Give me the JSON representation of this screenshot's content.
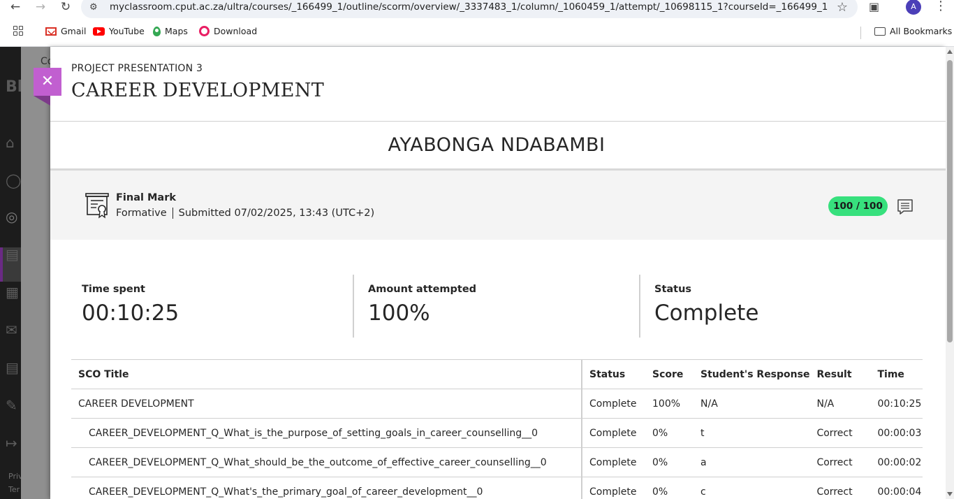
{
  "browser": {
    "url": "myclassroom.cput.ac.za/ultra/courses/_166499_1/outline/scorm/overview/_3337483_1/column/_1060459_1/attempt/_10698115_1?courseId=_166499_1",
    "profile_initial": "A",
    "bookmarks": [
      {
        "label": "Gmail",
        "icon": "gmail-icon"
      },
      {
        "label": "YouTube",
        "icon": "youtube-icon"
      },
      {
        "label": "Maps",
        "icon": "maps-icon"
      },
      {
        "label": "Download",
        "icon": "download-icon"
      }
    ],
    "all_bookmarks": "All Bookmarks"
  },
  "background": {
    "partial_text_1": "Co",
    "partial_logo": "Bl",
    "footer_1": "Priv",
    "footer_2": "Ter"
  },
  "panel": {
    "kicker": "PROJECT PRESENTATION 3",
    "title": "CAREER DEVELOPMENT",
    "student_name": "AYABONGA NDABAMBI",
    "grade": {
      "label": "Final Mark",
      "type": "Formative",
      "submitted": "Submitted 07/02/2025, 13:43 (UTC+2)",
      "score": "100 / 100",
      "score_fraction": 1.0
    },
    "stats": [
      {
        "label": "Time spent",
        "value": "00:10:25"
      },
      {
        "label": "Amount attempted",
        "value": "100%"
      },
      {
        "label": "Status",
        "value": "Complete"
      }
    ],
    "table": {
      "headers": [
        "SCO Title",
        "Status",
        "Score",
        "Student's Response",
        "Result",
        "Time"
      ],
      "rows": [
        {
          "title": "CAREER DEVELOPMENT",
          "status": "Complete",
          "score": "100%",
          "response": "N/A",
          "result": "N/A",
          "time": "00:10:25"
        },
        {
          "title": "CAREER_DEVELOPMENT_Q_What_is_the_purpose_of_setting_goals_in_career_counselling__0",
          "status": "Complete",
          "score": "0%",
          "response": "t",
          "result": "Correct",
          "time": "00:00:03"
        },
        {
          "title": "CAREER_DEVELOPMENT_Q_What_should_be_the_outcome_of_effective_career_counselling__0",
          "status": "Complete",
          "score": "0%",
          "response": "a",
          "result": "Correct",
          "time": "00:00:02"
        },
        {
          "title": "CAREER_DEVELOPMENT_Q_What's_the_primary_goal_of_career_development__0",
          "status": "Complete",
          "score": "0%",
          "response": "c",
          "result": "Correct",
          "time": "00:00:04"
        }
      ]
    }
  },
  "colors": {
    "close_button": "#c15fd0",
    "score_pill": "#37e07d",
    "grade_band": "#f4f4f4"
  }
}
